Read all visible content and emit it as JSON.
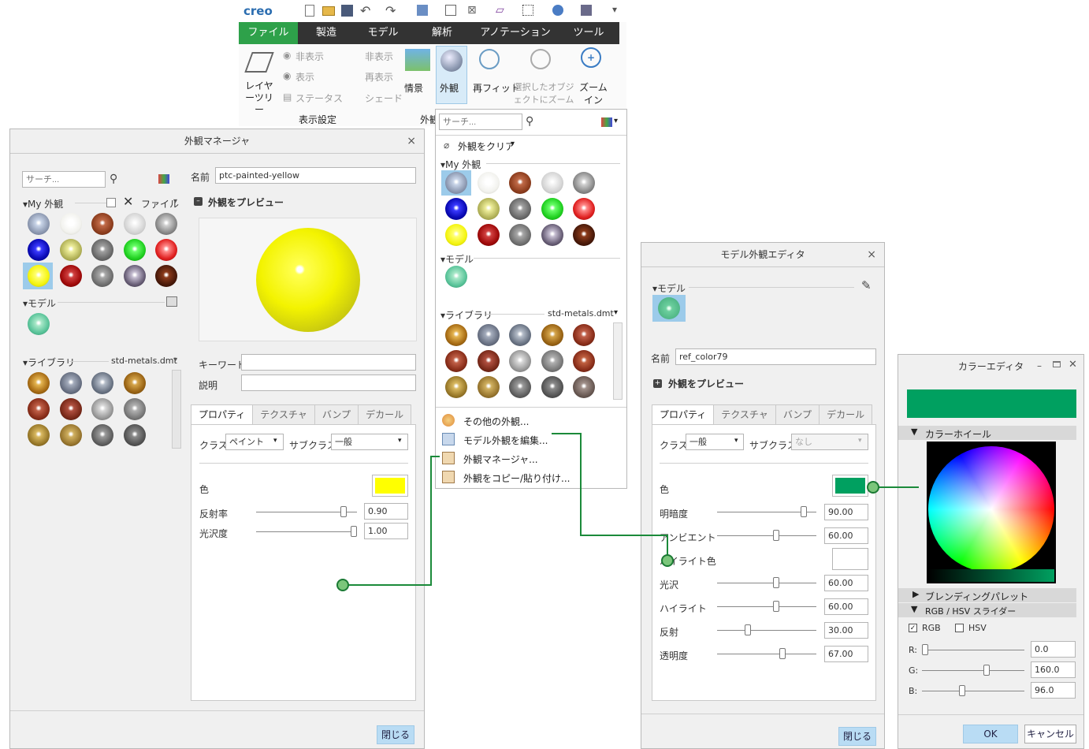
{
  "ribbon": {
    "logo": "creo",
    "tabs": [
      "ファイル",
      "製造",
      "モデル",
      "解析",
      "アノテーション",
      "ツール"
    ],
    "layer_tree": "レイヤーツリー",
    "hide": "非表示",
    "show": "表示",
    "status": "ステータス",
    "hide2": "非表示",
    "redisplay": "再表示",
    "shade": "シェード",
    "display_settings": "表示設定",
    "info": "情景",
    "appearance": "外観",
    "refit": "再フィット",
    "zoom_selected": "選択したオブジェクトにズーム",
    "zoom_in": "ズームイン",
    "group_appearance": "外観"
  },
  "am": {
    "title": "外観マネージャ",
    "close_x": "×",
    "search_placeholder": "サーチ...",
    "name_label": "名前",
    "name_value": "ptc-painted-yellow",
    "my_appearance": "▾My 外観",
    "file_menu": "ファイル",
    "preview": "外観をプレビュー",
    "model": "▾モデル",
    "library": "▾ライブラリ",
    "library_file": "std-metals.dmt",
    "keyword": "キーワード",
    "description": "説明",
    "tabs": [
      "プロパティ",
      "テクスチャ",
      "バンプ",
      "デカール"
    ],
    "class_label": "クラス",
    "class_value": "ペイント",
    "subclass_label": "サブクラス",
    "subclass_value": "一般",
    "color_label": "色",
    "color_hex": "#ffff00",
    "reflect_label": "反射率",
    "reflect_value": "0.90",
    "gloss_label": "光沢度",
    "gloss_value": "1.00",
    "close_button": "閉じる"
  },
  "dropdown": {
    "search_placeholder": "サーチ...",
    "clear": "外観をクリア",
    "my_appearance": "▾My 外観",
    "model": "▾モデル",
    "library": "▾ライブラリ",
    "library_file": "std-metals.dmt",
    "menu": [
      "その他の外観...",
      "モデル外観を編集...",
      "外観マネージャ...",
      "外観をコピー/貼り付け..."
    ]
  },
  "mae": {
    "title": "モデル外観エディタ",
    "close_x": "×",
    "model": "▾モデル",
    "name_label": "名前",
    "name_value": "ref_color79",
    "preview": "外観をプレビュー",
    "tabs": [
      "プロパティ",
      "テクスチャ",
      "バンプ",
      "デカール"
    ],
    "class_label": "クラス",
    "class_value": "一般",
    "subclass_label": "サブクラス",
    "subclass_value": "なし",
    "color_label": "色",
    "color_hex": "#00a060",
    "props": [
      {
        "label": "明暗度",
        "value": "90.00",
        "pos": 0.9
      },
      {
        "label": "アンビエント",
        "value": "60.00",
        "pos": 0.6
      },
      {
        "label": "ハイライト色",
        "value": "",
        "pos": null
      },
      {
        "label": "光沢",
        "value": "60.00",
        "pos": 0.6
      },
      {
        "label": "ハイライト",
        "value": "60.00",
        "pos": 0.6
      },
      {
        "label": "反射",
        "value": "30.00",
        "pos": 0.3
      },
      {
        "label": "透明度",
        "value": "67.00",
        "pos": 0.67
      }
    ],
    "close_button": "閉じる"
  },
  "ce": {
    "title": "カラーエディタ",
    "color_hex": "#00a060",
    "wheel_section": "カラーホイール",
    "blend_section": "ブレンディングパレット",
    "rgb_section": "RGB / HSV スライダー",
    "rgb_check": "RGB",
    "hsv_check": "HSV",
    "r_label": "R:",
    "r_value": "0.0",
    "g_label": "G:",
    "g_value": "160.0",
    "b_label": "B:",
    "b_value": "96.0",
    "ok": "OK",
    "cancel": "キャンセル"
  }
}
